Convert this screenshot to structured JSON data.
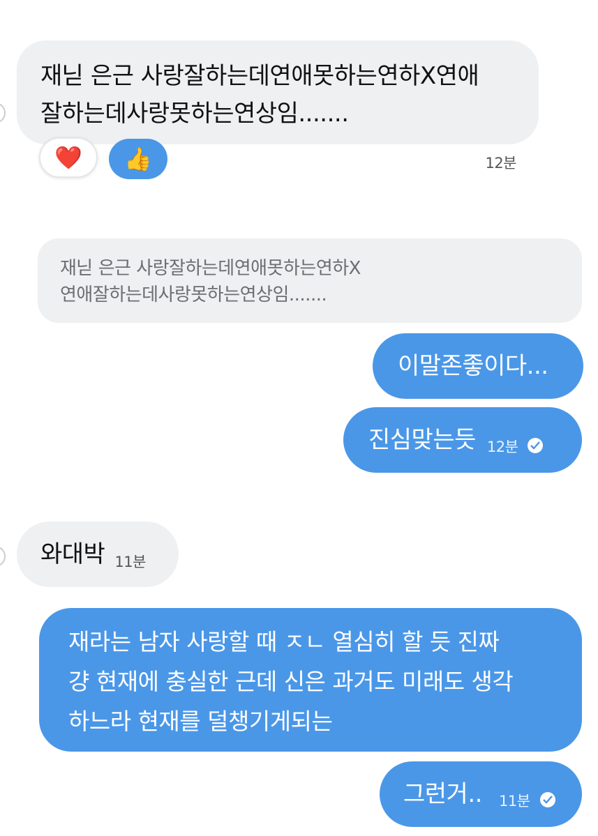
{
  "messages": {
    "m1": {
      "text": "재닏 은근 사랑잘하는데연애못하는연하X연애\n잘하는데사랑못하는연상임.......",
      "time": "12분"
    },
    "reactions": [
      {
        "icon": "heart-emoji",
        "glyph": "❤️"
      },
      {
        "icon": "thumbs-up-emoji",
        "glyph": "👍"
      }
    ],
    "quote": {
      "text": "재닏 은근 사랑잘하는데연애못하는연하X\n연애잘하는데사랑못하는연상임......."
    },
    "m2": {
      "text": "이말존좋이다..."
    },
    "m3": {
      "text": "진심맞는듯",
      "time": "12분"
    },
    "m4": {
      "text": "와대박",
      "time": "11분"
    },
    "m5": {
      "text": "재라는 남자 사랑할 때 ㅈㄴ 열심히 할 듯 진짜\n걍 현재에 충실한 근데 신은 과거도 미래도 생각\n하느라 현재를 덜챙기게되는"
    },
    "m6": {
      "text": "그런거..",
      "time": "11분"
    }
  },
  "colors": {
    "incoming_bubble": "#eef0f2",
    "outgoing_bubble": "#4a97e8",
    "reaction_heart_bg": "#ffffff",
    "reaction_thumbs_bg": "#4a97e8"
  }
}
